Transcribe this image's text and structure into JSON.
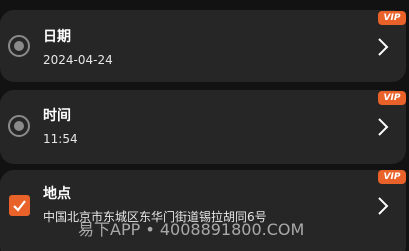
{
  "items": [
    {
      "title": "日期",
      "value": "2024-04-24",
      "checked": false,
      "badge": "VIP",
      "icon": "radio-icon"
    },
    {
      "title": "时间",
      "value": "11:54",
      "checked": false,
      "badge": "VIP",
      "icon": "radio-icon"
    },
    {
      "title": "地点",
      "value": "中国北京市东城区东华门街道锡拉胡同6号",
      "checked": true,
      "badge": "VIP",
      "icon": "checkbox-icon"
    }
  ],
  "watermark": "易下APP • 4008891800.COM",
  "colors": {
    "accent": "#e8622a",
    "card_bg": "#262626",
    "page_bg": "#121212"
  },
  "icons": {
    "chevron": "chevron-right-icon",
    "radio": "radio-icon",
    "checkbox": "checkbox-checked-icon"
  }
}
